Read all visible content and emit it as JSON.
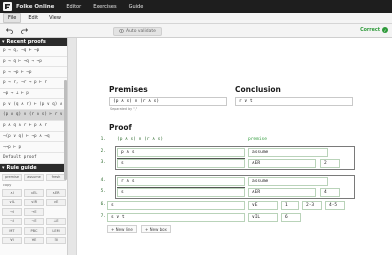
{
  "topbar": {
    "brand": "Folke Online",
    "nav": [
      "Editor",
      "Exercises",
      "Guide"
    ]
  },
  "menubar": {
    "items": [
      "File",
      "Edit",
      "View"
    ]
  },
  "toolbar": {
    "undo_icon": "undo-icon",
    "redo_icon": "redo-icon",
    "validate_label": "Auto validate",
    "status": "Correct"
  },
  "sidebar": {
    "recent_title": "Recent proofs",
    "recent": [
      "p → q, ¬q ⊢ ¬p",
      "p → q ⊢ ¬q → ¬p",
      "p → ¬p ⊢ ¬p",
      "p → r, ¬r → p ⊢ r",
      "¬p → ⊥ ⊢ p",
      "p ∨ (q ∧ r) ⊢ (p ∨ q) ∧ (p ∨ r)",
      "(p ∧ q) ∨ (r ∧ s) ⊢ r ∨ t",
      "p ∧ q ∧ r ⊢ p ∧ r",
      "¬(p ∨ q) ⊢ ¬p ∧ ¬q",
      "¬¬p ⊢ p",
      "Default proof"
    ],
    "selected_index": 6,
    "rules_title": "Rule guide",
    "rules_row1": [
      "premise",
      "assume",
      "fresh"
    ],
    "rules_label": "copy",
    "rules": [
      "∧I",
      "∧EL",
      "∧ER",
      "∨IL",
      "∨IR",
      "∨E",
      "→I",
      "→E",
      "",
      "¬I",
      "¬E",
      "⊥E",
      "MT",
      "PBC",
      "LEM",
      "∀I",
      "∀E",
      "∃I"
    ]
  },
  "main": {
    "premises_heading": "Premises",
    "conclusion_heading": "Conclusion",
    "premise_value": "(p ∧ s) ∨ (r ∧ s)",
    "conclusion_value": "r ∨ t",
    "separator_note": "Separated by \",\"",
    "proof_heading": "Proof",
    "lines": [
      {
        "num": "1.",
        "formula": "(p ∧ s) ∨ (r ∧ s)",
        "rule": "premise",
        "refs": []
      },
      {
        "num": "2.",
        "formula": "p ∧ s",
        "rule": "assume",
        "refs": []
      },
      {
        "num": "3.",
        "formula": "s",
        "rule": "∧ER",
        "refs": [
          "2"
        ]
      },
      {
        "num": "4.",
        "formula": "r ∧ s",
        "rule": "assume",
        "refs": []
      },
      {
        "num": "5.",
        "formula": "s",
        "rule": "∧ER",
        "refs": [
          "4"
        ]
      },
      {
        "num": "6.",
        "formula": "s",
        "rule": "∨E",
        "refs": [
          "1",
          "2-3",
          "4-5"
        ]
      },
      {
        "num": "7.",
        "formula": "s ∨ t",
        "rule": "∨IL",
        "refs": [
          "6"
        ]
      }
    ],
    "new_line_label": "+ New line",
    "new_box_label": "+ New box"
  }
}
